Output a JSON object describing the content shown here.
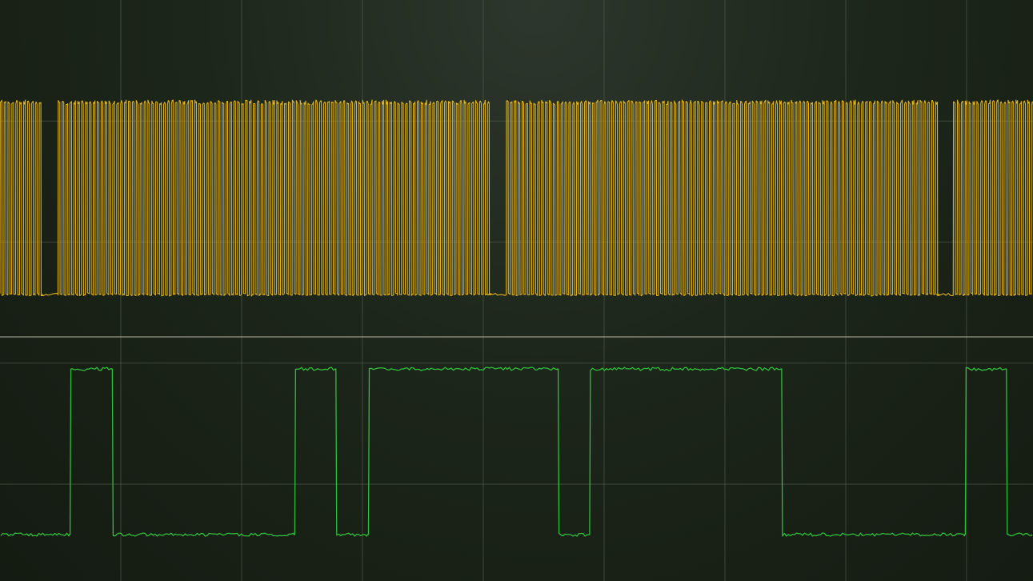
{
  "display": {
    "grid": true,
    "grid_divisions": {
      "x": 8.55,
      "y": 4.8
    },
    "colors": {
      "background_center": "#2e372d",
      "background_edge": "#141b12",
      "grid": "#5c6658",
      "separator": "#c8c8b4",
      "channel_1": "#e0b21c",
      "channel_2": "#2fbf3a"
    }
  },
  "chart_data": [
    {
      "type": "line",
      "name": "",
      "x_range": [
        0,
        8.55
      ],
      "y_range": [
        0,
        1
      ],
      "grid": true,
      "levels": {
        "low": 0,
        "high": 1
      },
      "carrier_period_div": 0.0323,
      "segments": [
        {
          "from": 0,
          "to": 0.34,
          "state": "toggling"
        },
        {
          "from": 0.34,
          "to": 0.48,
          "state": "low"
        },
        {
          "from": 0.48,
          "to": 4.04,
          "state": "toggling"
        },
        {
          "from": 4.04,
          "to": 4.19,
          "state": "low"
        },
        {
          "from": 4.19,
          "to": 7.75,
          "state": "toggling"
        },
        {
          "from": 7.75,
          "to": 7.89,
          "state": "low"
        },
        {
          "from": 7.89,
          "to": 8.55,
          "state": "toggling"
        }
      ]
    },
    {
      "type": "line",
      "name": "",
      "x_range": [
        0,
        8.55
      ],
      "y_range": [
        0,
        1
      ],
      "grid": true,
      "levels": {
        "low": 0,
        "high": 1
      },
      "transitions": [
        {
          "x": 0.0,
          "y": 0
        },
        {
          "x": 0.58,
          "y": 1
        },
        {
          "x": 0.93,
          "y": 0
        },
        {
          "x": 2.44,
          "y": 1
        },
        {
          "x": 2.78,
          "y": 0
        },
        {
          "x": 3.05,
          "y": 1
        },
        {
          "x": 4.62,
          "y": 0
        },
        {
          "x": 4.88,
          "y": 1
        },
        {
          "x": 6.47,
          "y": 0
        },
        {
          "x": 7.99,
          "y": 1
        },
        {
          "x": 8.33,
          "y": 0
        }
      ]
    }
  ]
}
